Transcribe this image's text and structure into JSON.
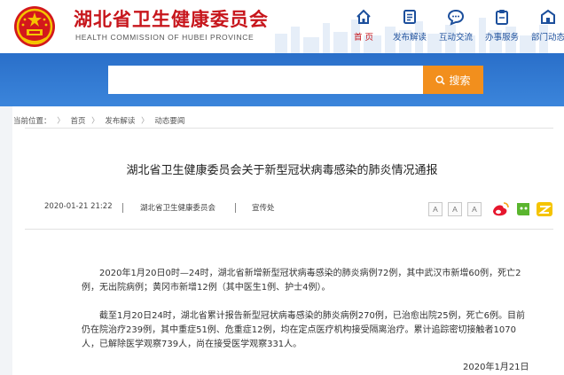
{
  "header": {
    "title": "湖北省卫生健康委员会",
    "subtitle": "HEALTH COMMISSION OF HUBEI PROVINCE",
    "nav": [
      {
        "label": "首 页",
        "icon": "home-icon",
        "active": true
      },
      {
        "label": "发布解读",
        "icon": "document-icon",
        "active": false
      },
      {
        "label": "互动交流",
        "icon": "chat-icon",
        "active": false
      },
      {
        "label": "办事服务",
        "icon": "clipboard-icon",
        "active": false
      },
      {
        "label": "部门动态",
        "icon": "building-icon",
        "active": false
      }
    ]
  },
  "search": {
    "placeholder": "",
    "button_label": "搜索"
  },
  "breadcrumb": {
    "prefix": "当前位置：",
    "items": [
      "首页",
      "发布解读",
      "动态要闻"
    ],
    "separator": "〉"
  },
  "article": {
    "title": "湖北省卫生健康委员会关于新型冠状病毒感染的肺炎情况通报",
    "datetime": "2020-01-21 21:22",
    "source": "湖北省卫生健康委员会",
    "publisher": "宣传处",
    "font_sizes": [
      "A",
      "A",
      "A"
    ],
    "paragraphs": [
      "2020年1月20日0时—24时，湖北省新增新型冠状病毒感染的肺炎病例72例，其中武汉市新增60例，死亡2例，无出院病例；黄冈市新增12例（其中医生1例、护士4例）。",
      "截至1月20日24时，湖北省累计报告新型冠状病毒感染的肺炎病例270例，已治愈出院25例，死亡6例。目前仍在院治疗239例，其中重症51例、危重症12例，均在定点医疗机构接受隔离治疗。累计追踪密切接触者1070人，已解除医学观察739人，尚在接受医学观察331人。"
    ],
    "sign_date": "2020年1月21日"
  },
  "colors": {
    "brand_red": "#c7161c",
    "nav_blue": "#1c4f9c",
    "band_blue": "#2a6fc9",
    "search_orange": "#f28f1d"
  },
  "share_icons": [
    "weibo-icon",
    "wechat-icon",
    "qzone-icon"
  ]
}
